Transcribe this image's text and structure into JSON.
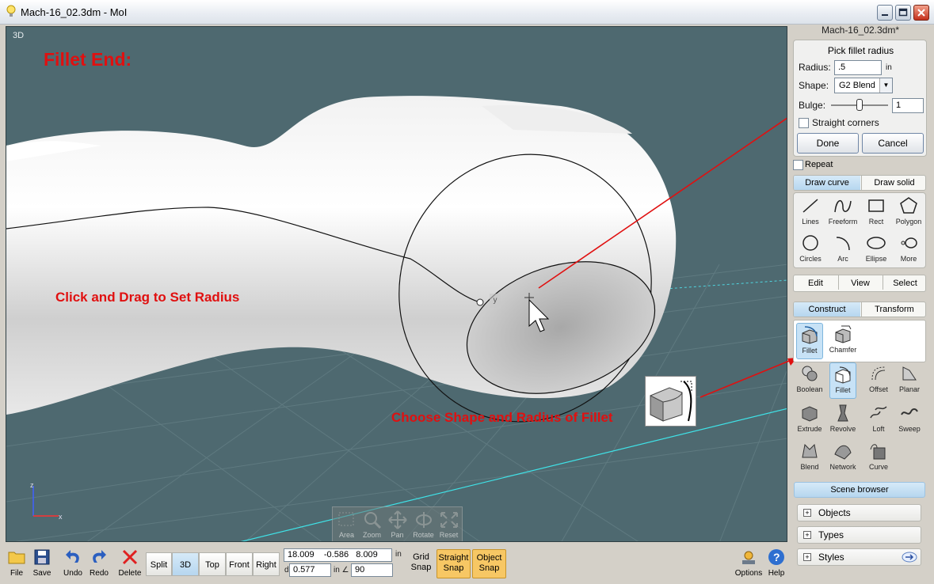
{
  "window": {
    "title": "Mach-16_02.3dm - MoI"
  },
  "viewport": {
    "label": "3D",
    "annotations": {
      "heading": "Fillet End:",
      "drag_hint": "Click and Drag to Set Radius",
      "shape_hint": "Choose Shape and Radius of Fillet"
    },
    "cursor_label": "y",
    "nav": [
      "Area",
      "Zoom",
      "Pan",
      "Rotate",
      "Reset"
    ],
    "axes": {
      "z": "z",
      "x": "x"
    }
  },
  "panel": {
    "doc_title": "Mach-16_02.3dm*",
    "prompt": "Pick fillet radius",
    "radius_label": "Radius:",
    "radius_value": ".5",
    "radius_unit": "in",
    "shape_label": "Shape:",
    "shape_value": "G2 Blend",
    "bulge_label": "Bulge:",
    "bulge_value": "1",
    "bulge_level": 0.5,
    "straight_corners": "Straight corners",
    "done": "Done",
    "cancel": "Cancel",
    "repeat": "Repeat",
    "draw_tabs": [
      "Draw curve",
      "Draw solid"
    ],
    "draw_tools": [
      "Lines",
      "Freeform",
      "Rect",
      "Polygon",
      "Circles",
      "Arc",
      "Ellipse",
      "More"
    ],
    "mode_tabs": [
      "Edit",
      "View",
      "Select"
    ],
    "construct_tabs": [
      "Construct",
      "Transform"
    ],
    "fillet_sub": [
      "Fillet",
      "Chamfer"
    ],
    "construct_tools": [
      "Boolean",
      "Fillet",
      "Offset",
      "Planar",
      "Extrude",
      "Revolve",
      "Loft",
      "Sweep",
      "Blend",
      "Network",
      "Curve"
    ],
    "scene_browser": "Scene browser",
    "scene_items": [
      "Objects",
      "Types",
      "Styles"
    ]
  },
  "bottom": {
    "file": "File",
    "save": "Save",
    "undo": "Undo",
    "redo": "Redo",
    "delete": "Delete",
    "views": [
      "Split",
      "3D",
      "Top",
      "Front",
      "Right"
    ],
    "coord_x": "18.009",
    "coord_y": "-0.586",
    "coord_z": "8.009",
    "coord_unit": "in",
    "d_label": "d",
    "d_value": "0.577",
    "angle_unit": "in ∠",
    "angle_value": "90",
    "grid_snap": [
      "Grid",
      "Snap"
    ],
    "straight_snap": [
      "Straight",
      "Snap"
    ],
    "object_snap": [
      "Object",
      "Snap"
    ],
    "options": "Options",
    "help": "Help"
  },
  "colors": {
    "annotation": "#e01010",
    "active_tab": "#b6d6ef",
    "snap_on": "#f7c764",
    "viewport_bg": "#4e6970"
  }
}
